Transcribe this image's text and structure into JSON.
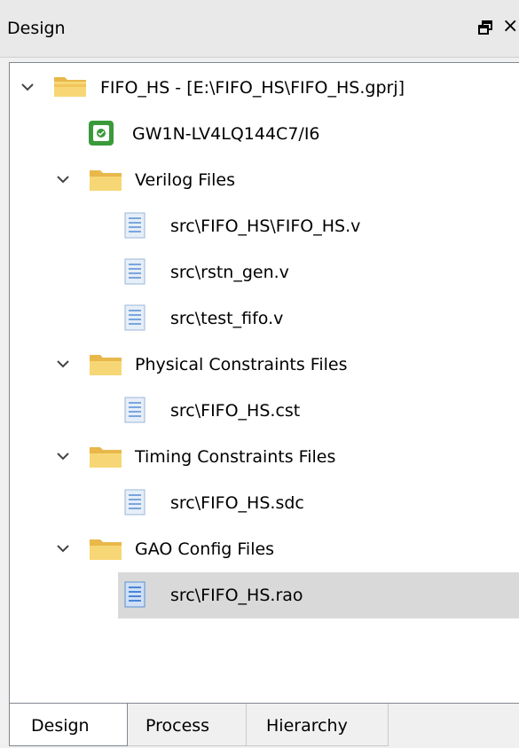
{
  "panel": {
    "title": "Design",
    "float_button_icon": "float-window-icon",
    "close_button_label": "×"
  },
  "tree": {
    "project": {
      "label": "FIFO_HS - [E:\\FIFO_HS\\FIFO_HS.gprj]",
      "icon": "project-folder-icon"
    },
    "device": {
      "label": "GW1N-LV4LQ144C7/I6",
      "icon": "device-chip-icon"
    },
    "groups": [
      {
        "label": "Verilog Files",
        "icon": "folder-icon",
        "files": [
          "src\\FIFO_HS\\FIFO_HS.v",
          "src\\rstn_gen.v",
          "src\\test_fifo.v"
        ]
      },
      {
        "label": "Physical Constraints Files",
        "icon": "folder-icon",
        "files": [
          "src\\FIFO_HS.cst"
        ]
      },
      {
        "label": "Timing Constraints Files",
        "icon": "folder-icon",
        "files": [
          "src\\FIFO_HS.sdc"
        ]
      },
      {
        "label": "GAO Config Files",
        "icon": "folder-icon",
        "files": [
          "src\\FIFO_HS.rao"
        ]
      }
    ],
    "selected_item": "src\\FIFO_HS.rao"
  },
  "tabs": [
    {
      "label": "Design",
      "active": true
    },
    {
      "label": "Process",
      "active": false
    },
    {
      "label": "Hierarchy",
      "active": false
    }
  ],
  "colors": {
    "folder": "#f7d775",
    "folder_dark": "#e8b84a",
    "file_page": "#e6eef8",
    "file_lines": "#7aa6dd",
    "chip_green": "#3a9a3a",
    "selection": "#d9d9d9",
    "border": "#828790"
  }
}
